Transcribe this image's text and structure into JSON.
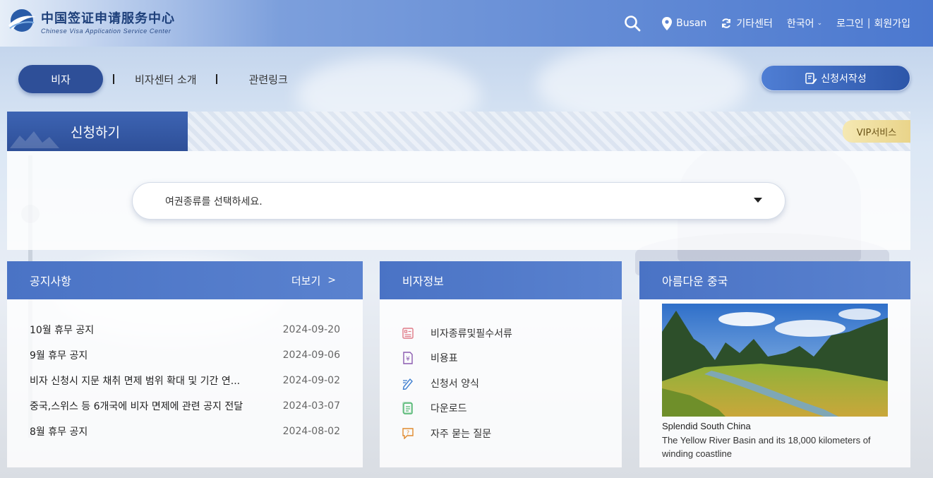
{
  "header": {
    "logo_cn": "中国签证申请服务中心",
    "logo_en": "Chinese Visa Application Service Center",
    "location": "Busan",
    "other_center": "기타센터",
    "language": "한국어",
    "login": "로그인",
    "separator": "|",
    "signup": "회원가입"
  },
  "subnav": {
    "active": "비자",
    "items": [
      "비자센터 소개",
      "관련링크"
    ]
  },
  "form_button": "신청서작성",
  "apply": {
    "title": "신청하기",
    "vip": "VIP서비스",
    "select_placeholder": "여권종류를 선택하세요."
  },
  "notice": {
    "title": "공지사항",
    "more": "더보기",
    "items": [
      {
        "title": "10월 휴무 공지",
        "date": "2024-09-20"
      },
      {
        "title": "9월 휴무 공지",
        "date": "2024-09-06"
      },
      {
        "title": "비자 신청시 지문 채취 면제 범위 확대 및 기간 연...",
        "date": "2024-09-02"
      },
      {
        "title": "중국,스위스 등 6개국에 비자 면제에 관련 공지 전달",
        "date": "2024-03-07"
      },
      {
        "title": "8월 휴무 공지",
        "date": "2024-08-02"
      }
    ]
  },
  "visa_info": {
    "title": "비자정보",
    "items": [
      {
        "label": "비자종류및필수서류",
        "icon": "document-list-icon",
        "color": "#e07a86"
      },
      {
        "label": "비용표",
        "icon": "yen-icon",
        "color": "#8a5bb0"
      },
      {
        "label": "신청서 양식",
        "icon": "pen-icon",
        "color": "#3f7fd0"
      },
      {
        "label": "다운로드",
        "icon": "download-doc-icon",
        "color": "#49b36a"
      },
      {
        "label": "자주 묻는 질문",
        "icon": "faq-icon",
        "color": "#e08a2e"
      }
    ]
  },
  "china": {
    "title": "아름다운 중국",
    "caption_title": "Splendid South China",
    "caption_text": "The Yellow River Basin and its 18,000 kilometers of winding coastline"
  },
  "colors": {
    "primary": "#2e4f98",
    "panel_head": "#4a73c5",
    "vip_gold": "#e9d48a"
  }
}
